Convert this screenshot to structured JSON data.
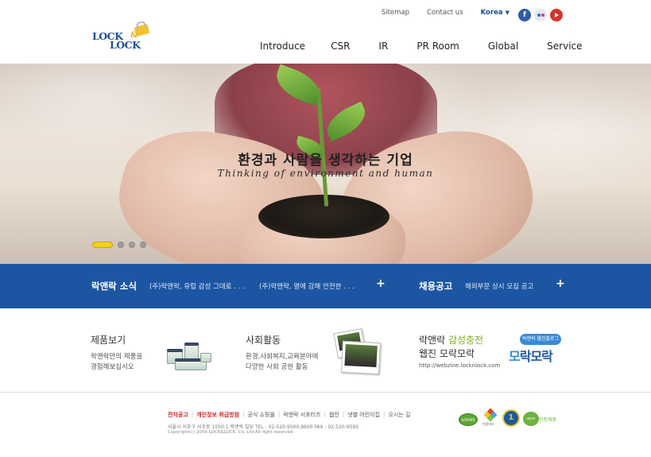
{
  "header": {
    "utility": {
      "sitemap": "Sitemap",
      "contact": "Contact us",
      "language": "Korea",
      "language_caret": "▼"
    },
    "social": {
      "facebook": "f",
      "flickr": "flickr",
      "youtube": "youtube"
    },
    "logo": {
      "line1": "LOCK",
      "amp": "&",
      "line2": "LOCK"
    },
    "nav": [
      "Introduce",
      "CSR",
      "IR",
      "PR Room",
      "Global",
      "Service"
    ]
  },
  "hero": {
    "title": "환경과 사람을 생각하는 기업",
    "subtitle": "Thinking of environment and human",
    "slides_total": 4,
    "slides_active": 1
  },
  "newsbar": {
    "news_title": "락앤락 소식",
    "news_items": [
      "(주)락앤락, 유럽 감성 그대로 . . .",
      "(주)락앤락, 열에 강해 안전한 . . ."
    ],
    "news_more": "+",
    "jobs_title": "채용공고",
    "jobs_item": "해외부문 상시 모집 공고",
    "jobs_more": "+"
  },
  "boxes": {
    "products": {
      "title": "제품보기",
      "desc1": "락앤락만의 제품을",
      "desc2": "경험해보십시오"
    },
    "social": {
      "title": "사회활동",
      "desc1": "환경,사회복지,교육분야에",
      "desc2": "다양한 사회 공헌 활동"
    },
    "webzine": {
      "title_pre": "락앤락 ",
      "title_hl": "감성충전",
      "title2": "웹진 모락모락",
      "url": "http://webzine.locknlock.com",
      "badge": "락앤락 웹진블로그",
      "logo_mo": "모",
      "logo_rest": "락모락"
    }
  },
  "footer": {
    "links": [
      {
        "label": "전자공고",
        "highlight": true
      },
      {
        "label": "개인정보 취급방침",
        "highlight": true
      },
      {
        "label": "공식 쇼핑몰",
        "highlight": false
      },
      {
        "label": "락앤락 서포터즈",
        "highlight": false
      },
      {
        "label": "웹진",
        "highlight": false
      },
      {
        "label": "샛별 어린이집",
        "highlight": false
      },
      {
        "label": "오시는 길",
        "highlight": false
      }
    ],
    "separator": "|",
    "address": "서울시 서초구 서초동 1550-1 락앤락 빌딩  TEL : 02-520-9500,9600  FAX : 02-520-9595",
    "copyright": "Copyright(c) 2009 LOCK&LOCK. Co, Ltd All right reserved.",
    "certs": {
      "lohas": "LOHAS",
      "cert2": "인증마크",
      "number": "1",
      "eco": "eco",
      "eco_text": "인증제품"
    }
  },
  "colors": {
    "brand_blue": "#1c56a2",
    "accent_yellow": "#f1d216",
    "link_red": "#d0241f",
    "green": "#7cb21c"
  }
}
